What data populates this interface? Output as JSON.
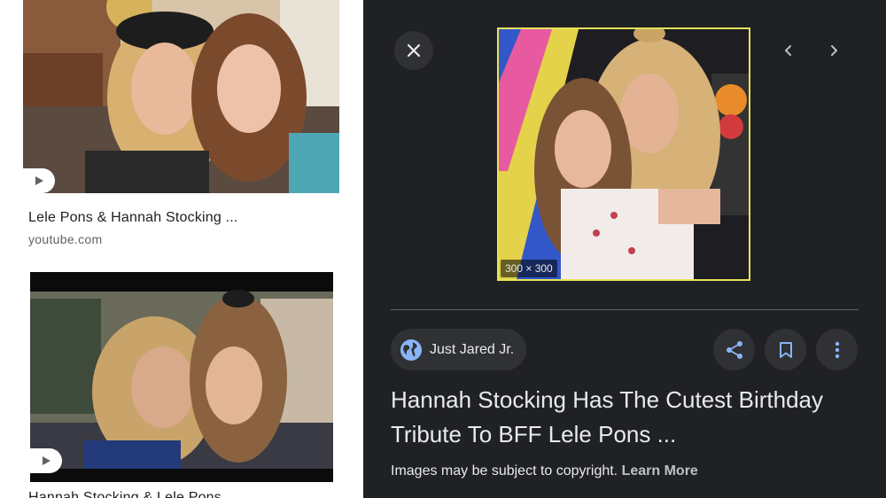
{
  "results": [
    {
      "caption": "Lele Pons & Hannah Stocking ...",
      "domain": "youtube.com",
      "play_icon": "play-icon"
    },
    {
      "caption": "Hannah Stocking & Lele Pons ...",
      "play_icon": "play-icon"
    }
  ],
  "viewer": {
    "close_icon": "close-icon",
    "prev_icon": "chevron-left-icon",
    "next_icon": "chevron-right-icon",
    "dimensions": "300 × 300",
    "source": "Just Jared Jr.",
    "title": "Hannah Stocking Has The Cutest Birthday Tribute To BFF Lele Pons ...",
    "copyright_text": "Images may be subject to copyright.",
    "learn_more": "Learn More",
    "accent_color": "#e6e35a",
    "action_icon_color": "#8ab4f8"
  }
}
